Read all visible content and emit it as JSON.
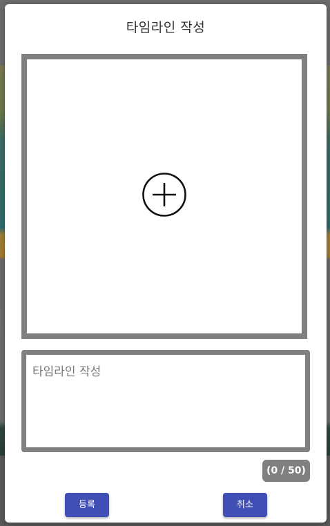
{
  "modal": {
    "title": "타임라인 작성",
    "image_upload": {
      "icon": "plus-circle-icon"
    },
    "caption": {
      "placeholder": "타임라인 작성",
      "value": ""
    },
    "char_counter": "(0 / 50)",
    "buttons": {
      "submit_label": "등록",
      "cancel_label": "취소"
    }
  },
  "colors": {
    "accent": "#3f4fb5",
    "border_gray": "#808080",
    "modal_bg": "#ffffff"
  }
}
